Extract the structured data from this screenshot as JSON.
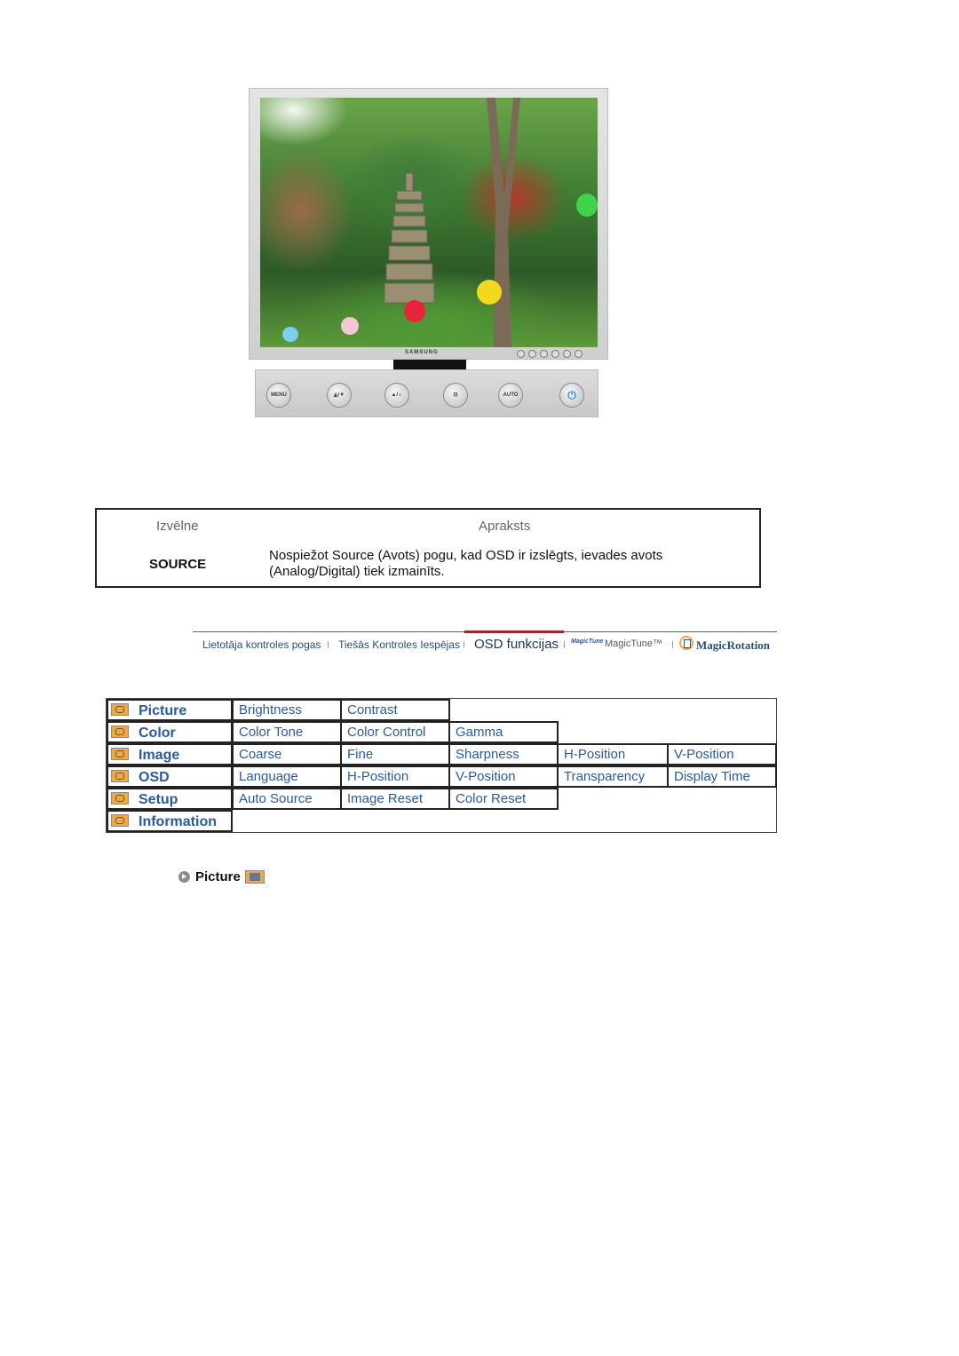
{
  "monitor": {
    "brand": "SAMSUNG",
    "panel_buttons": [
      {
        "icon": "menu-icon",
        "label": "MENU"
      },
      {
        "icon": "magicbright-down-icon",
        "label": "◭/▼"
      },
      {
        "icon": "up-brightness-icon",
        "label": "▲/☼"
      },
      {
        "icon": "source-icon",
        "label": "⊡"
      },
      {
        "icon": "auto-icon",
        "label": "AUTO"
      },
      {
        "icon": "power-icon",
        "label": "⏻"
      }
    ]
  },
  "description_table": {
    "header_menu": "Izvēlne",
    "header_description": "Apraksts",
    "rows": [
      {
        "menu": "SOURCE",
        "description": "Nospiežot Source (Avots) pogu, kad OSD ir izslēgts, ievades avots (Analog/Digital) tiek izmainīts."
      }
    ]
  },
  "nav": {
    "items": [
      {
        "label": "Lietotāja kontroles pogas",
        "active": false
      },
      {
        "label": "Tiešās Kontroles Iespējas",
        "active": false
      },
      {
        "label": "OSD funkcijas",
        "active": true
      },
      {
        "label": "MagicTune™",
        "active": false
      },
      {
        "label": "MagicRotation",
        "active": false
      }
    ],
    "magictune_logo": "MagicTune"
  },
  "osd_menu": {
    "categories": [
      {
        "label": "Picture",
        "icon": "picture-icon",
        "items": [
          "Brightness",
          "Contrast"
        ]
      },
      {
        "label": "Color",
        "icon": "color-icon",
        "items": [
          "Color Tone",
          "Color Control",
          "Gamma"
        ]
      },
      {
        "label": "Image",
        "icon": "image-icon",
        "items": [
          "Coarse",
          "Fine",
          "Sharpness",
          "H-Position",
          "V-Position"
        ]
      },
      {
        "label": "OSD",
        "icon": "osd-icon",
        "items": [
          "Language",
          "H-Position",
          "V-Position",
          "Transparency",
          "Display Time"
        ]
      },
      {
        "label": "Setup",
        "icon": "setup-icon",
        "items": [
          "Auto Source",
          "Image Reset",
          "Color Reset"
        ]
      },
      {
        "label": "Information",
        "icon": "information-icon",
        "items": []
      }
    ]
  },
  "section_link": {
    "label": "Picture"
  },
  "colors": {
    "link_blue": "#2a5aa0",
    "icon_orange": "#f0a93a",
    "nav_active_red": "#9a2a2a"
  }
}
